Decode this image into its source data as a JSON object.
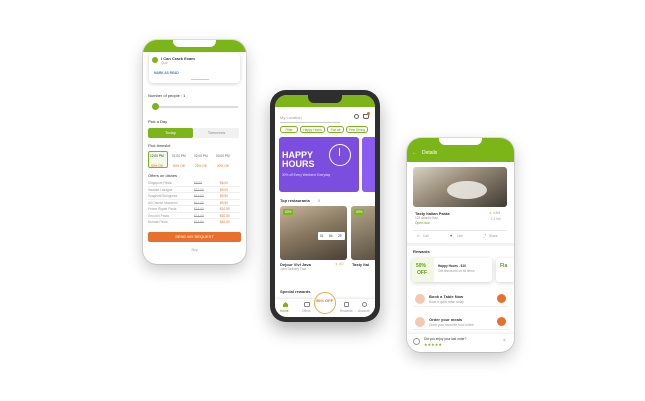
{
  "left_phone": {
    "card_title": "I Can Crack Exam",
    "card_sub": "Quiz",
    "card_link": "MARK AS READ",
    "people_label": "Number of people : 1",
    "day_label": "Pick a Day",
    "day_options": [
      "Today",
      "Tomorrow"
    ],
    "time_label": "Pick timeslot",
    "timeslots": [
      "12:00 PM",
      "01:00 PM",
      "02:00 PM",
      "03:00 PM"
    ],
    "timeslot_offers": [
      "50% Off",
      "50% Off",
      "25% Off",
      "30% Off"
    ],
    "offers_label": "Offers on dishes",
    "dishes": [
      {
        "name": "Singapore Pasta",
        "old": "$8.00",
        "new": "$6.00"
      },
      {
        "name": "Insalata Lasagna",
        "old": "$12.00",
        "new": "$9.00"
      },
      {
        "name": "Spaghetti Bolognese",
        "old": "$14.00",
        "new": "$9.50"
      },
      {
        "name": "All Cheese Macaroni",
        "old": "$12.00",
        "new": "$9.50"
      },
      {
        "name": "Penne Rigate Pasta",
        "old": "$14.00",
        "new": "$10.50"
      },
      {
        "name": "Gnocchi Pasta",
        "old": "$14.00",
        "new": "$10.50"
      },
      {
        "name": "Burrata Pasta",
        "old": "$14.00",
        "new": "$10.00"
      }
    ],
    "send_button": "SEND MY REQUEST",
    "footer_link": "Skip"
  },
  "center_phone": {
    "location_placeholder": "My Location",
    "filters": [
      "Filter",
      "Happy Hours",
      "Flat off",
      "Fine Dining"
    ],
    "banner_title_1": "HAPPY",
    "banner_title_2": "HOURS",
    "banner_sub": "30% off Every Weekend Everyday",
    "top_label": "Top restaurants",
    "top_count": "5",
    "restaurants": [
      {
        "name": "Dejour Vivi Java",
        "addr": "Joint Delivery Fast",
        "badge": "50%",
        "rating": "4.0",
        "timer": [
          "01",
          "54",
          "29"
        ]
      },
      {
        "name": "Tasty Ital",
        "addr": "",
        "badge": "50%",
        "rating": "",
        "timer": []
      }
    ],
    "special_label": "Special rewards",
    "reward_center": "50% OFF",
    "nav": [
      "Home",
      "Offers",
      "Rewards",
      "Account"
    ]
  },
  "right_phone": {
    "header_title": "Details",
    "restaurant_name": "Tasty Italian Pasta",
    "restaurant_addr": "123 Atlantic Bay",
    "restaurant_link": "Open now",
    "rating": "4.5/5",
    "distance": "1.2 km",
    "actions": [
      "Call",
      "Like",
      "Share"
    ],
    "rewards_label": "Rewards",
    "reward_card": {
      "badge_top": "50%",
      "badge_bot": "OFF",
      "title": "Happy Hours - $10",
      "desc": "Get discounts on all items"
    },
    "reward_peek": "Fla",
    "list": [
      {
        "title": "Book a Table Now",
        "desc": "Book a quick table today"
      },
      {
        "title": "Order your meals",
        "desc": "Order your favourite food online"
      }
    ],
    "feedback": "Did you enjoy your last order?",
    "stars": "★★★★★"
  },
  "colors": {
    "accent": "#7cb518",
    "cta": "#e8702a",
    "banner": "#7b4ee0"
  }
}
